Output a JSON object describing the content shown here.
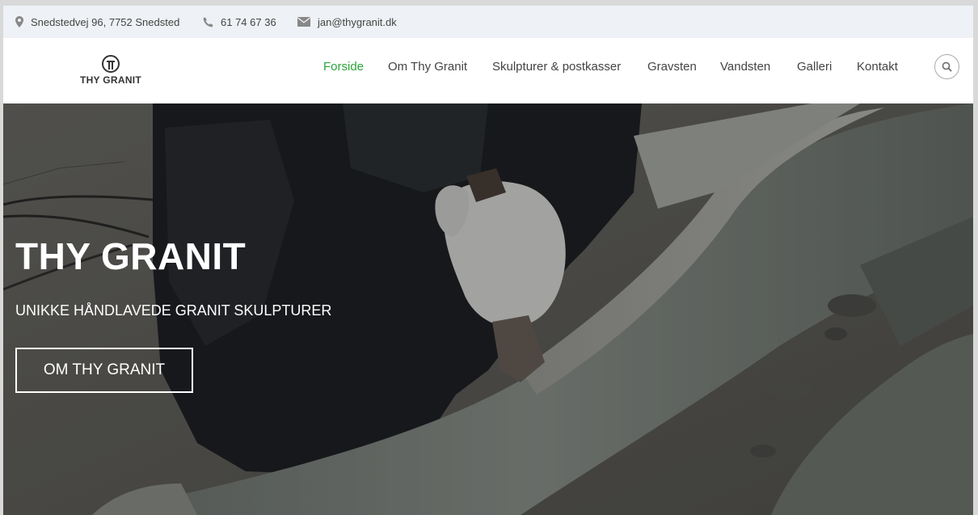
{
  "topbar": {
    "address": "Snedstedvej 96, 7752 Snedsted",
    "phone": "61 74 67 36",
    "email": "jan@thygranit.dk"
  },
  "logo": {
    "text": "THY GRANIT"
  },
  "nav": {
    "items": [
      {
        "label": "Forside",
        "active": true
      },
      {
        "label": "Om Thy Granit",
        "active": false
      },
      {
        "label": "Skulpturer & postkasser",
        "active": false
      },
      {
        "label": "Gravsten",
        "active": false
      },
      {
        "label": "Vandsten",
        "active": false
      },
      {
        "label": "Galleri",
        "active": false
      },
      {
        "label": "Kontakt",
        "active": false
      }
    ],
    "search_icon": "search-icon"
  },
  "hero": {
    "title": "THY GRANIT",
    "subtitle": "UNIKKE HÅNDLAVEDE GRANIT SKULPTURER",
    "button_label": "OM THY GRANIT"
  },
  "colors": {
    "accent": "#2aa53a",
    "topbar_bg": "#eef1f5",
    "text": "#444444"
  }
}
